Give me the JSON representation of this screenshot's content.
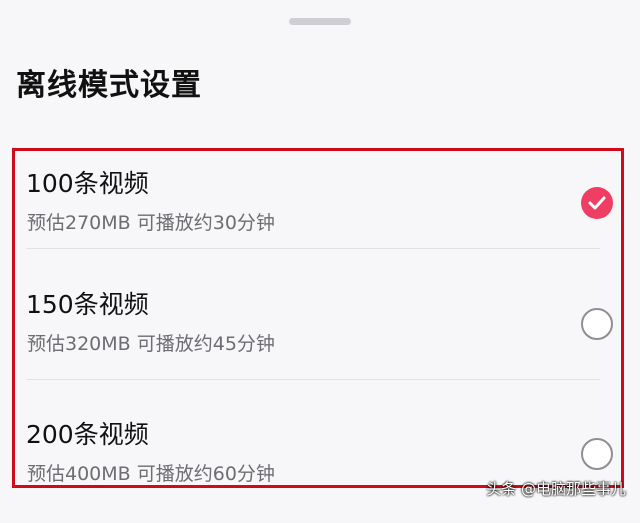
{
  "title": "离线模式设置",
  "options": [
    {
      "label": "100条视频",
      "sub": "预估270MB 可播放约30分钟",
      "selected": true
    },
    {
      "label": "150条视频",
      "sub": "预估320MB 可播放约45分钟",
      "selected": false
    },
    {
      "label": "200条视频",
      "sub": "预估400MB 可播放约60分钟",
      "selected": false
    }
  ],
  "watermark": "头条 @电脑那些事儿",
  "colors": {
    "accent": "#ef3d63",
    "highlight_border": "#d00b17"
  }
}
